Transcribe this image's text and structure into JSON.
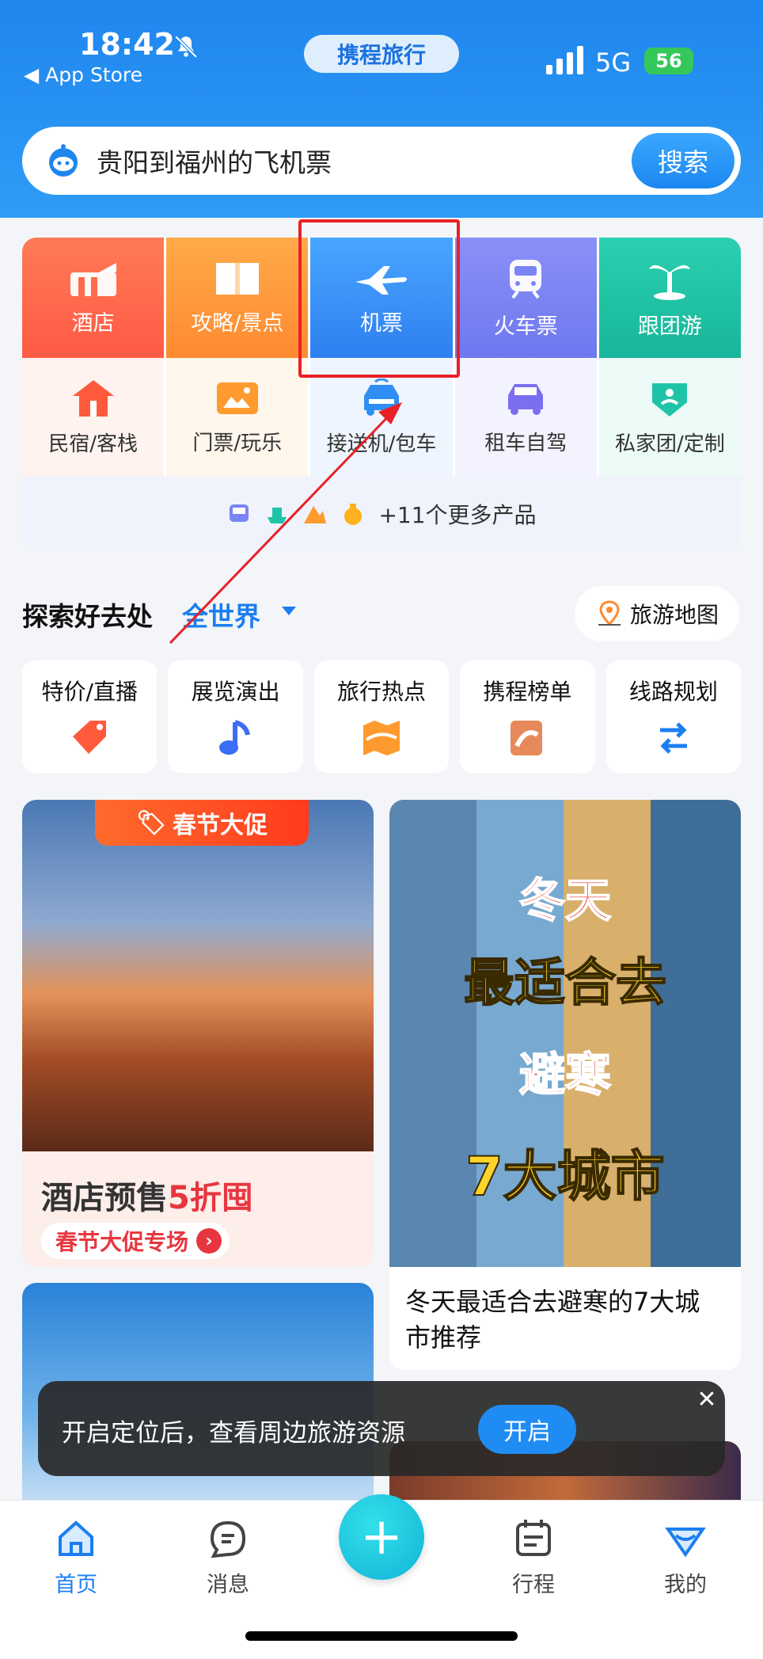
{
  "status_bar": {
    "time": "18:42",
    "back_label": "◀ App Store",
    "network": "5G",
    "battery": "56"
  },
  "brand": {
    "name": "携程旅行"
  },
  "search": {
    "query": "贵阳到福州的飞机票",
    "button": "搜索"
  },
  "main_grid": [
    {
      "label": "酒店",
      "icon": "hotel-icon",
      "color": "#ff6b4a"
    },
    {
      "label": "攻略/景点",
      "icon": "guide-book-icon",
      "color": "#ff9a3a"
    },
    {
      "label": "机票",
      "icon": "airplane-icon",
      "color": "#2f8ef3"
    },
    {
      "label": "火车票",
      "icon": "train-icon",
      "color": "#7b84f3"
    },
    {
      "label": "跟团游",
      "icon": "palm-tree-icon",
      "color": "#1fc4a8"
    }
  ],
  "sub_grid": [
    {
      "label": "民宿/客栈",
      "icon": "house-icon"
    },
    {
      "label": "门票/玩乐",
      "icon": "ticket-icon"
    },
    {
      "label": "接送机/包车",
      "icon": "transfer-car-icon"
    },
    {
      "label": "租车自驾",
      "icon": "rental-car-icon"
    },
    {
      "label": "私家团/定制",
      "icon": "custom-tour-icon"
    }
  ],
  "more_products": "+11个更多产品",
  "explore": {
    "title": "探索好去处",
    "region": "全世界",
    "map_button": "旅游地图"
  },
  "quick_links": [
    {
      "label": "特价/直播",
      "icon": "price-tag-icon"
    },
    {
      "label": "展览演出",
      "icon": "music-note-icon"
    },
    {
      "label": "旅行热点",
      "icon": "hot-map-icon"
    },
    {
      "label": "携程榜单",
      "icon": "ranking-icon"
    },
    {
      "label": "线路规划",
      "icon": "route-icon"
    }
  ],
  "feed": {
    "card1": {
      "tag": "春节大促",
      "headline_a": "酒店预售",
      "headline_b": "5折囤",
      "link": "春节大促专场"
    },
    "card2": {
      "line1": "冬天",
      "line2": "最适合去",
      "line3": "避寒",
      "line4": "7大城市",
      "caption": "冬天最适合去避寒的7大城市推荐"
    }
  },
  "toast": {
    "message": "开启定位后，查看周边旅游资源",
    "button": "开启"
  },
  "tabs": [
    {
      "label": "首页",
      "icon": "home-icon"
    },
    {
      "label": "消息",
      "icon": "message-icon"
    },
    {
      "label": "行程",
      "icon": "calendar-icon"
    },
    {
      "label": "我的",
      "icon": "profile-diamond-icon"
    }
  ],
  "colors": {
    "accent": "#1b7ef0",
    "highlight_box": "#ea2027"
  }
}
